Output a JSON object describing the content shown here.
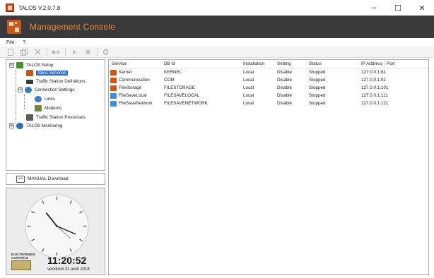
{
  "window": {
    "title": "TALOS  V.2.0.7.8",
    "minimize": "–",
    "maximize": "☐",
    "close": "✕"
  },
  "banner": {
    "title": "Management Console"
  },
  "menu": {
    "items": [
      "File",
      "?"
    ]
  },
  "toolbar": {
    "buttons": [
      "new-icon",
      "open-icon",
      "delete-icon",
      "connect-icon",
      "play-icon",
      "stop-icon",
      "refresh-icon"
    ]
  },
  "tree": {
    "items": [
      {
        "label": "TALOS Setup",
        "expander": "⊟",
        "icon": "setup-icon"
      },
      {
        "label": "Talos Services",
        "expander": "",
        "icon": "services-icon",
        "selected": true
      },
      {
        "label": "Traffic Station Definitions",
        "expander": "",
        "icon": "station-defs-icon"
      },
      {
        "label": "Connection Settings",
        "expander": "⊟",
        "icon": "connection-icon"
      },
      {
        "label": "Links",
        "expander": "",
        "icon": "links-icon"
      },
      {
        "label": "Modems",
        "expander": "",
        "icon": "modems-icon"
      },
      {
        "label": "Traffic Station Processes",
        "expander": "",
        "icon": "processes-icon"
      },
      {
        "label": "TALOS Monitoring",
        "expander": "⊞",
        "icon": "monitoring-icon"
      }
    ]
  },
  "manual": {
    "label": "MANUAL Download"
  },
  "clock": {
    "time": "11:20:52",
    "date": "vendredi 31 août 2018",
    "brand": "ELECTRONIQUE CONTRÔLE"
  },
  "table": {
    "columns": [
      "Service",
      "DB Id",
      "Installation",
      "Setting",
      "Status",
      "IP Address",
      "Port"
    ],
    "rows": [
      {
        "icon": "kernel-icon",
        "service": "Kernel",
        "db_id": "KERNEL",
        "installation": "Local",
        "setting": "Disable",
        "status": "Stopped",
        "ip_port": "127.0.0.1:81"
      },
      {
        "icon": "communication-icon",
        "service": "Communication",
        "db_id": "COM",
        "installation": "Local",
        "setting": "Disable",
        "status": "Stopped",
        "ip_port": "127.0.0.1:91"
      },
      {
        "icon": "filestorage-icon",
        "service": "FileStorage",
        "db_id": "FILESTORAGE",
        "installation": "Local",
        "setting": "Disable",
        "status": "Stopped",
        "ip_port": "127.0.0.1:101"
      },
      {
        "icon": "filesavelocal-icon",
        "service": "FileSaveLocal",
        "db_id": "FILESAVELOCAL",
        "installation": "Local",
        "setting": "Disable",
        "status": "Stopped",
        "ip_port": "127.0.0.1:111"
      },
      {
        "icon": "filesavenetwork-icon",
        "service": "FileSaveNetwork",
        "db_id": "FILESAVENETWORK",
        "installation": "Local",
        "setting": "Disable",
        "status": "Stopped",
        "ip_port": "127.0.0.1:121"
      }
    ]
  },
  "colors": {
    "banner_bg": "#3a3a3a",
    "banner_title": "#e98a3c",
    "selection": "#2f6dc7",
    "service_icon_orange": "#c9561a",
    "service_icon_blue": "#3d8fd6"
  }
}
